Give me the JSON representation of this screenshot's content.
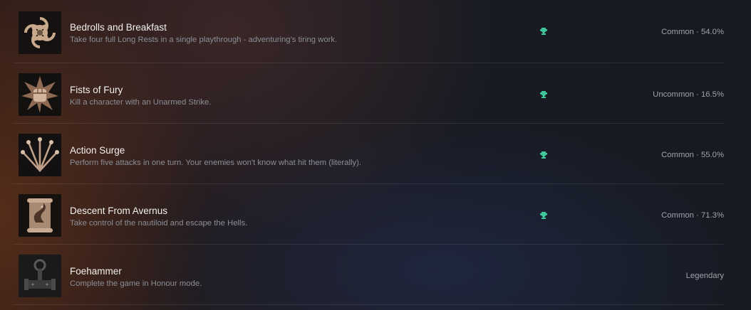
{
  "achievements": [
    {
      "title": "Bedrolls and Breakfast",
      "description": "Take four full Long Rests in a single playthrough - adventuring's tiring work.",
      "has_trophy": true,
      "rarity": "Common · 54.0%",
      "icon": "swirl-rings-icon"
    },
    {
      "title": "Fists of Fury",
      "description": "Kill a character with an Unarmed Strike.",
      "has_trophy": true,
      "rarity": "Uncommon · 16.5%",
      "icon": "spiked-fist-icon"
    },
    {
      "title": "Action Surge",
      "description": "Perform five attacks in one turn. Your enemies won't know what hit them (literally).",
      "has_trophy": true,
      "rarity": "Common · 55.0%",
      "icon": "five-swords-icon"
    },
    {
      "title": "Descent From Avernus",
      "description": "Take control of the nautiloid and escape the Hells.",
      "has_trophy": true,
      "rarity": "Common · 71.3%",
      "icon": "scroll-dragon-icon"
    },
    {
      "title": "Foehammer",
      "description": "Complete the game in Honour mode.",
      "has_trophy": false,
      "rarity": "Legendary",
      "icon": "honour-hammer-icon"
    }
  ],
  "colors": {
    "trophy": "#3fc79a",
    "title": "#f2f0ee",
    "description": "#8b8e96"
  }
}
